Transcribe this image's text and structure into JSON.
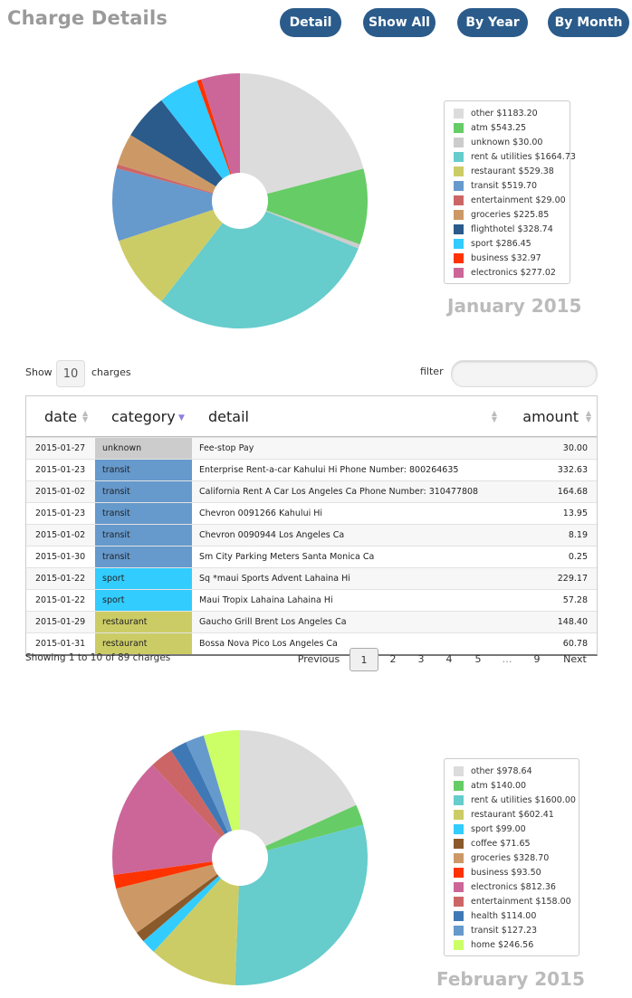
{
  "header": {
    "title": "Charge Details",
    "buttons": [
      "Detail",
      "Show All",
      "By Year",
      "By Month"
    ]
  },
  "chart_data": [
    {
      "type": "pie",
      "title": "January 2015",
      "categories": [
        "other",
        "atm",
        "unknown",
        "rent & utilities",
        "restaurant",
        "transit",
        "entertainment",
        "groceries",
        "flighthotel",
        "sport",
        "business",
        "electronics"
      ],
      "values": [
        1183.2,
        543.25,
        30.0,
        1664.73,
        529.38,
        519.7,
        29.0,
        225.85,
        328.74,
        286.45,
        32.97,
        277.02
      ],
      "labels": [
        "other $1183.20",
        "atm $543.25",
        "unknown $30.00",
        "rent & utilities $1664.73",
        "restaurant $529.38",
        "transit $519.70",
        "entertainment $29.00",
        "groceries $225.85",
        "flighthotel $328.74",
        "sport $286.45",
        "business $32.97",
        "electronics $277.02"
      ],
      "colors": [
        "#dcdcdc",
        "#66cc66",
        "#cccccc",
        "#66cccc",
        "#cccc66",
        "#6699cc",
        "#cc6666",
        "#cc9966",
        "#2a5b8b",
        "#33ccff",
        "#ff3300",
        "#cc6699"
      ],
      "legend": "right"
    },
    {
      "type": "pie",
      "title": "February 2015",
      "categories": [
        "other",
        "atm",
        "rent & utilities",
        "restaurant",
        "sport",
        "coffee",
        "groceries",
        "business",
        "electronics",
        "entertainment",
        "health",
        "transit",
        "home"
      ],
      "values": [
        978.64,
        140.0,
        1600.0,
        602.41,
        99.0,
        71.65,
        328.7,
        93.5,
        812.36,
        158.0,
        114.0,
        127.23,
        246.56
      ],
      "labels": [
        "other $978.64",
        "atm $140.00",
        "rent & utilities $1600.00",
        "restaurant $602.41",
        "sport $99.00",
        "coffee $71.65",
        "groceries $328.70",
        "business $93.50",
        "electronics $812.36",
        "entertainment $158.00",
        "health $114.00",
        "transit $127.23",
        "home $246.56"
      ],
      "colors": [
        "#dcdcdc",
        "#66cc66",
        "#66cccc",
        "#cccc66",
        "#33ccff",
        "#8b5a2b",
        "#cc9966",
        "#ff3300",
        "#cc6699",
        "#cc6666",
        "#3f79b5",
        "#6699cc",
        "#ccff66"
      ],
      "legend": "right"
    }
  ],
  "controls": {
    "show_label": "Show",
    "length_value": "10",
    "charges_label": "charges",
    "filter_label": "filter",
    "filter_value": ""
  },
  "table": {
    "columns": [
      "date",
      "category",
      "detail",
      "amount"
    ],
    "category_colors": {
      "unknown": "#cccccc",
      "transit": "#6699cc",
      "sport": "#33ccff",
      "restaurant": "#cccc66"
    },
    "rows": [
      {
        "date": "2015-01-27",
        "category": "unknown",
        "detail": "Fee-stop Pay",
        "amount": "30.00"
      },
      {
        "date": "2015-01-23",
        "category": "transit",
        "detail": "Enterprise Rent-a-car Kahului Hi Phone Number: 800264635",
        "amount": "332.63"
      },
      {
        "date": "2015-01-02",
        "category": "transit",
        "detail": "California Rent A Car Los Angeles Ca Phone Number: 310477808",
        "amount": "164.68"
      },
      {
        "date": "2015-01-23",
        "category": "transit",
        "detail": "Chevron 0091266 Kahului Hi",
        "amount": "13.95"
      },
      {
        "date": "2015-01-02",
        "category": "transit",
        "detail": "Chevron 0090944 Los Angeles Ca",
        "amount": "8.19"
      },
      {
        "date": "2015-01-30",
        "category": "transit",
        "detail": "Sm City Parking Meters Santa Monica Ca",
        "amount": "0.25"
      },
      {
        "date": "2015-01-22",
        "category": "sport",
        "detail": "Sq *maui Sports Advent Lahaina Hi",
        "amount": "229.17"
      },
      {
        "date": "2015-01-22",
        "category": "sport",
        "detail": "Maui Tropix Lahaina Lahaina Hi",
        "amount": "57.28"
      },
      {
        "date": "2015-01-29",
        "category": "restaurant",
        "detail": "Gaucho Grill Brent Los Angeles Ca",
        "amount": "148.40"
      },
      {
        "date": "2015-01-31",
        "category": "restaurant",
        "detail": "Bossa Nova Pico Los Angeles Ca",
        "amount": "60.78"
      }
    ],
    "info": "Showing 1 to 10 of 89 charges"
  },
  "pagination": {
    "previous": "Previous",
    "pages": [
      "1",
      "2",
      "3",
      "4",
      "5",
      "…",
      "9"
    ],
    "current": "1",
    "next": "Next"
  }
}
